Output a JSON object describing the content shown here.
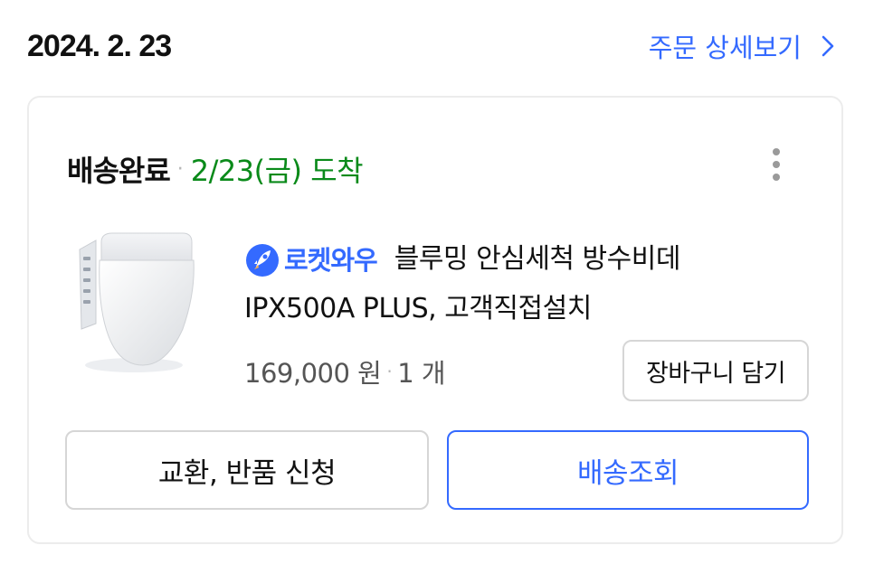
{
  "order": {
    "date": "2024. 2. 23",
    "detail_link_label": "주문 상세보기"
  },
  "shipment": {
    "status": "배송완료",
    "arrival": "2/23(금) 도착"
  },
  "product": {
    "badge": "로켓와우",
    "title_line1": "블루밍 안심세척 방수비데",
    "title_line2": "IPX500A PLUS, 고객직접설치",
    "price": "169,000 원",
    "quantity": "1 개"
  },
  "buttons": {
    "add_to_cart": "장바구니 담기",
    "exchange_return": "교환, 반품 신청",
    "track_delivery": "배송조회"
  },
  "colors": {
    "accent": "#346aff",
    "arrival": "#0a8a1a",
    "border": "#d6d6d6"
  },
  "icons": {
    "detail": "chevron-right-icon",
    "badge": "rocket-icon",
    "menu": "more-vertical-icon"
  }
}
